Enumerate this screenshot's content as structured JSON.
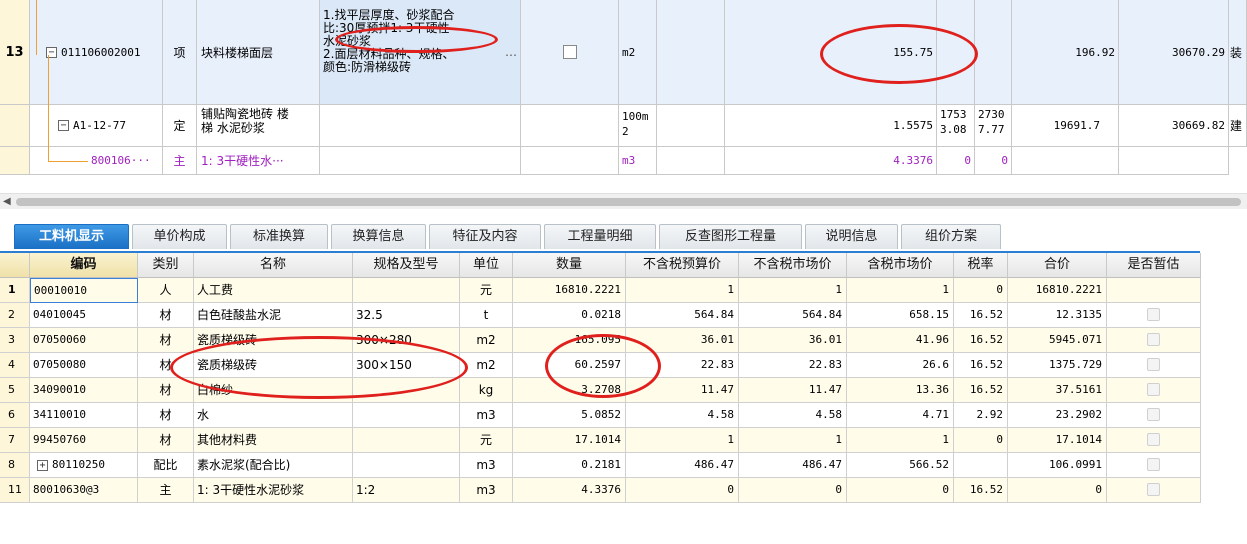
{
  "top_table": {
    "row13": {
      "row_no": "13",
      "code": "011106002001",
      "type": "项",
      "name": "块料楼梯面层",
      "features": [
        "1.找平层厚度、砂浆配合",
        "比:30厚预拌1: 3干硬性",
        "水泥砂浆",
        "2.面层材料品种、规格、",
        "颜色:防滑梯级砖"
      ],
      "ellipsis": "…",
      "unit": "m2",
      "quantity": "155.75",
      "unit_price": "196.92",
      "total": "30670.29",
      "tail": "装"
    },
    "sub1": {
      "code": "A1-12-77",
      "type": "定",
      "name_l1": "铺贴陶瓷地砖 楼",
      "name_l2": "梯 水泥砂浆",
      "unit_l1": "100m",
      "unit_l2": "2",
      "quantity": "1.5575",
      "p1_l1": "1753",
      "p1_l2": "3.08",
      "p2_l1": "2730",
      "p2_l2": "7.77",
      "unit_price": "19691.7",
      "total": "30669.82",
      "tail": "建"
    },
    "sub2": {
      "code": "800106···",
      "type": "主",
      "name": "1: 3干硬性水···",
      "unit": "m3",
      "quantity": "4.3376",
      "p1": "0",
      "p2": "0"
    },
    "tree_collapse": "−"
  },
  "scrollbar": {
    "arrow": "◀"
  },
  "tabs": [
    {
      "label": "工料机显示",
      "active": true
    },
    {
      "label": "单价构成"
    },
    {
      "label": "标准换算"
    },
    {
      "label": "换算信息"
    },
    {
      "label": "特征及内容"
    },
    {
      "label": "工程量明细"
    },
    {
      "label": "反查图形工程量"
    },
    {
      "label": "说明信息"
    },
    {
      "label": "组价方案"
    }
  ],
  "columns": [
    "编码",
    "类别",
    "名称",
    "规格及型号",
    "单位",
    "数量",
    "不含税预算价",
    "不含税市场价",
    "含税市场价",
    "税率",
    "合价",
    "是否暂估"
  ],
  "rows": [
    {
      "no": "1",
      "code": "00010010",
      "cat": "人",
      "name": "人工费",
      "spec": "",
      "unit": "元",
      "qty": "16810.2221",
      "p1": "1",
      "p2": "1",
      "p3": "1",
      "tax": "0",
      "total": "16810.2221",
      "est": false
    },
    {
      "no": "2",
      "code": "04010045",
      "cat": "材",
      "name": "白色硅酸盐水泥",
      "spec": "32.5",
      "unit": "t",
      "qty": "0.0218",
      "p1": "564.84",
      "p2": "564.84",
      "p3": "658.15",
      "tax": "16.52",
      "total": "12.3135",
      "est": true
    },
    {
      "no": "3",
      "code": "07050060",
      "cat": "材",
      "name": "瓷质梯级砖",
      "spec": "300×280",
      "unit": "m2",
      "qty": "165.095",
      "p1": "36.01",
      "p2": "36.01",
      "p3": "41.96",
      "tax": "16.52",
      "total": "5945.071",
      "est": true
    },
    {
      "no": "4",
      "code": "07050080",
      "cat": "材",
      "name": "瓷质梯级砖",
      "spec": "300×150",
      "unit": "m2",
      "qty": "60.2597",
      "p1": "22.83",
      "p2": "22.83",
      "p3": "26.6",
      "tax": "16.52",
      "total": "1375.729",
      "est": true
    },
    {
      "no": "5",
      "code": "34090010",
      "cat": "材",
      "name": "白棉纱",
      "spec": "",
      "unit": "kg",
      "qty": "3.2708",
      "p1": "11.47",
      "p2": "11.47",
      "p3": "13.36",
      "tax": "16.52",
      "total": "37.5161",
      "est": true
    },
    {
      "no": "6",
      "code": "34110010",
      "cat": "材",
      "name": "水",
      "spec": "",
      "unit": "m3",
      "qty": "5.0852",
      "p1": "4.58",
      "p2": "4.58",
      "p3": "4.71",
      "tax": "2.92",
      "total": "23.2902",
      "est": true
    },
    {
      "no": "7",
      "code": "99450760",
      "cat": "材",
      "name": "其他材料费",
      "spec": "",
      "unit": "元",
      "qty": "17.1014",
      "p1": "1",
      "p2": "1",
      "p3": "1",
      "tax": "0",
      "total": "17.1014",
      "est": true
    },
    {
      "no": "8",
      "code": "80110250",
      "cat": "配比",
      "name": "素水泥浆(配合比)",
      "spec": "",
      "unit": "m3",
      "qty": "0.2181",
      "p1": "486.47",
      "p2": "486.47",
      "p3": "566.52",
      "tax": "",
      "total": "106.0991",
      "est": true,
      "expand": "+"
    },
    {
      "no": "11",
      "code": "80010630@3",
      "cat": "主",
      "name": "1: 3干硬性水泥砂浆",
      "spec": "1:2",
      "unit": "m3",
      "qty": "4.3376",
      "p1": "0",
      "p2": "0",
      "p3": "0",
      "tax": "16.52",
      "total": "0",
      "est": true
    }
  ],
  "colors": {
    "tab_active": "#1a6fc4",
    "annotation": "#e0201c",
    "row_header": "#fdf6d8",
    "sub_item": "#a020c0"
  }
}
